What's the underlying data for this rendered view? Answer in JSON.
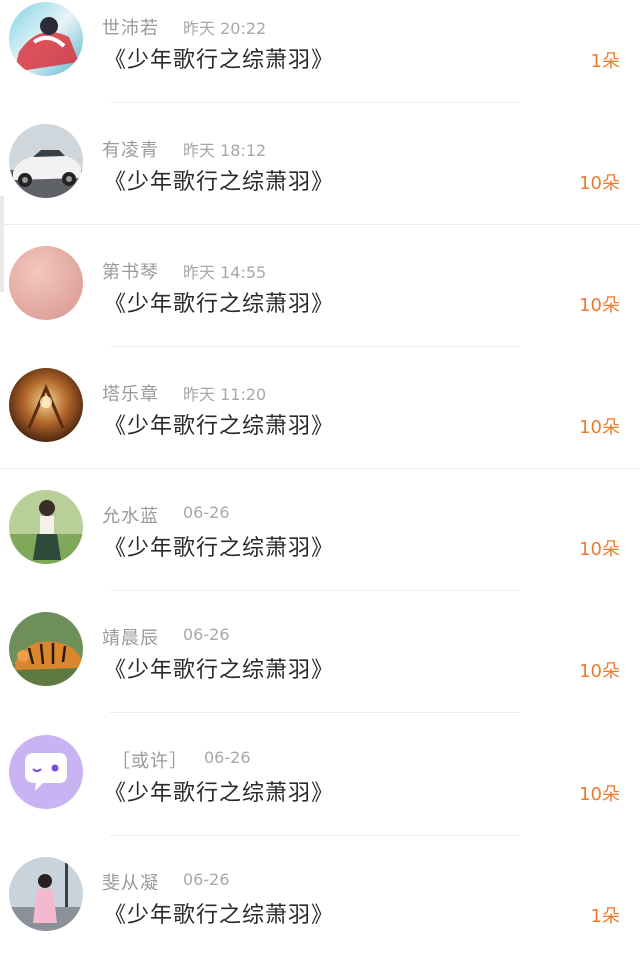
{
  "items": [
    {
      "name": "世沛若",
      "time": "昨天 20:22",
      "title": "《少年歌行之综萧羽》",
      "gift": "1朵",
      "avatar_icon": "avatar-user-photo"
    },
    {
      "name": "有凌青",
      "time": "昨天 18:12",
      "title": "《少年歌行之综萧羽》",
      "gift": "10朵",
      "avatar_icon": "avatar-car"
    },
    {
      "name": "第书琴",
      "time": "昨天 14:55",
      "title": "《少年歌行之综萧羽》",
      "gift": "10朵",
      "avatar_icon": "avatar-pink-gradient"
    },
    {
      "name": "塔乐章",
      "time": "昨天 11:20",
      "title": "《少年歌行之综萧羽》",
      "gift": "10朵",
      "avatar_icon": "avatar-fantasy-art"
    },
    {
      "name": "允水蓝",
      "time": "06-26",
      "title": "《少年歌行之综萧羽》",
      "gift": "10朵",
      "avatar_icon": "avatar-girl-outdoor"
    },
    {
      "name": "靖晨辰",
      "time": "06-26",
      "title": "《少年歌行之综萧羽》",
      "gift": "10朵",
      "avatar_icon": "avatar-tiger"
    },
    {
      "name": "［或许］",
      "time": "06-26",
      "title": "《少年歌行之综萧羽》",
      "gift": "10朵",
      "avatar_icon": "avatar-purple-chat-bubble"
    },
    {
      "name": "斐从凝",
      "time": "06-26",
      "title": "《少年歌行之综萧羽》",
      "gift": "1朵",
      "avatar_icon": "avatar-girl-street"
    }
  ],
  "colors": {
    "gift": "#ef7a2c",
    "name": "#9a9a9a",
    "title": "#2a2a2a",
    "divider": "#ececec"
  }
}
